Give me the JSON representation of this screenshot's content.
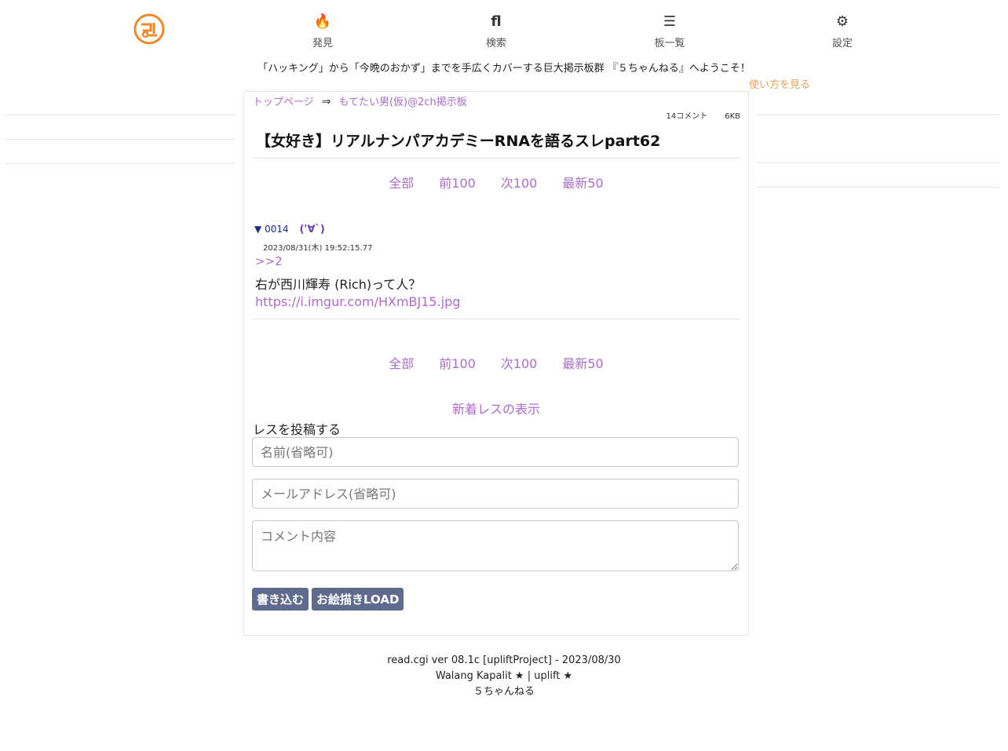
{
  "nav": {
    "discover": {
      "label": "発見",
      "icon": "fire-icon",
      "glyph": "🔥"
    },
    "search": {
      "label": "検索",
      "icon": "search-icon",
      "glyph": "fl"
    },
    "boards": {
      "label": "板一覧",
      "icon": "list-icon",
      "glyph": "☰"
    },
    "settings": {
      "label": "設定",
      "icon": "gear-icon",
      "glyph": "⚙"
    }
  },
  "welcome": "「ハッキング」から「今晩のおかず」までを手広くカバーする巨大掲示板群 『５ちゃんねる』へようこそ！",
  "howto": "使い方を見る",
  "breadcrumb": {
    "top": "トップページ",
    "arrow": "⇒",
    "board": "もてたい男(仮)@2ch掲示板"
  },
  "thread": {
    "comments": "14コメント",
    "size": "6KB",
    "title": "【女好き】リアルナンパアカデミーRNAを語るスレpart62"
  },
  "pager": {
    "all": "全部",
    "prev": "前100",
    "next": "次100",
    "latest": "最新50"
  },
  "post": {
    "marker": "▼",
    "number": "0014",
    "name": "('∀`)",
    "date": "2023/08/31(木) 19:52:15.77",
    "anchor": ">>2",
    "body": "右が西川輝寿 (Rich)って人？",
    "link": "https://i.imgur.com/HXmBJ15.jpg"
  },
  "new_res": "新着レスの表示",
  "form": {
    "title": "レスを投稿する",
    "name_placeholder": "名前(省略可)",
    "mail_placeholder": "メールアドレス(省略可)",
    "comment_placeholder": "コメント内容",
    "submit": "書き込む",
    "oekaki": "お絵描きLOAD"
  },
  "footer": {
    "line1": "read.cgi ver 08.1c [upliftProject] - 2023/08/30",
    "line2": "Walang Kapalit ★ | uplift ★",
    "line3": "５ちゃんねる"
  },
  "colors": {
    "accent": "#b06bd0",
    "logo": "#f0892a",
    "button": "#5e6b8f",
    "howto": "#e8a25b"
  }
}
